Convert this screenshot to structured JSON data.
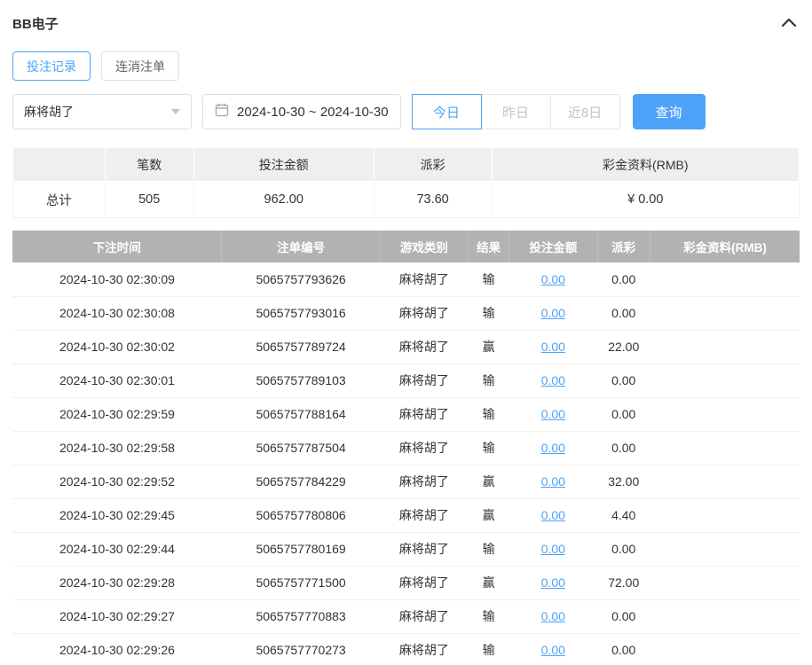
{
  "accent_color": "#4da3f7",
  "header": {
    "title": "BB电子"
  },
  "tabs": [
    {
      "label": "投注记录",
      "active": true
    },
    {
      "label": "连消注单",
      "active": false
    }
  ],
  "filters": {
    "game_select_value": "麻将胡了",
    "date_range_value": "2024-10-30 ~ 2024-10-30",
    "quick_buttons": [
      {
        "label": "今日",
        "active": true
      },
      {
        "label": "昨日",
        "active": false
      },
      {
        "label": "近8日",
        "active": false
      }
    ],
    "search_label": "查询"
  },
  "summary": {
    "headers": [
      "",
      "笔数",
      "投注金额",
      "派彩",
      "彩金资料(RMB)"
    ],
    "row_label": "总计",
    "count": "505",
    "bet_total": "962.00",
    "payout_total": "73.60",
    "bonus_total": "¥ 0.00"
  },
  "table": {
    "headers": [
      "下注时间",
      "注单编号",
      "游戏类别",
      "结果",
      "投注金额",
      "派彩",
      "彩金资料(RMB)"
    ],
    "rows": [
      {
        "time": "2024-10-30 02:30:09",
        "order": "5065757793626",
        "game": "麻将胡了",
        "result": "输",
        "bet": "0.00",
        "payout": "0.00",
        "bonus": ""
      },
      {
        "time": "2024-10-30 02:30:08",
        "order": "5065757793016",
        "game": "麻将胡了",
        "result": "输",
        "bet": "0.00",
        "payout": "0.00",
        "bonus": ""
      },
      {
        "time": "2024-10-30 02:30:02",
        "order": "5065757789724",
        "game": "麻将胡了",
        "result": "赢",
        "bet": "0.00",
        "payout": "22.00",
        "bonus": ""
      },
      {
        "time": "2024-10-30 02:30:01",
        "order": "5065757789103",
        "game": "麻将胡了",
        "result": "输",
        "bet": "0.00",
        "payout": "0.00",
        "bonus": ""
      },
      {
        "time": "2024-10-30 02:29:59",
        "order": "5065757788164",
        "game": "麻将胡了",
        "result": "输",
        "bet": "0.00",
        "payout": "0.00",
        "bonus": ""
      },
      {
        "time": "2024-10-30 02:29:58",
        "order": "5065757787504",
        "game": "麻将胡了",
        "result": "输",
        "bet": "0.00",
        "payout": "0.00",
        "bonus": ""
      },
      {
        "time": "2024-10-30 02:29:52",
        "order": "5065757784229",
        "game": "麻将胡了",
        "result": "赢",
        "bet": "0.00",
        "payout": "32.00",
        "bonus": ""
      },
      {
        "time": "2024-10-30 02:29:45",
        "order": "5065757780806",
        "game": "麻将胡了",
        "result": "赢",
        "bet": "0.00",
        "payout": "4.40",
        "bonus": ""
      },
      {
        "time": "2024-10-30 02:29:44",
        "order": "5065757780169",
        "game": "麻将胡了",
        "result": "输",
        "bet": "0.00",
        "payout": "0.00",
        "bonus": ""
      },
      {
        "time": "2024-10-30 02:29:28",
        "order": "5065757771500",
        "game": "麻将胡了",
        "result": "赢",
        "bet": "0.00",
        "payout": "72.00",
        "bonus": ""
      },
      {
        "time": "2024-10-30 02:29:27",
        "order": "5065757770883",
        "game": "麻将胡了",
        "result": "输",
        "bet": "0.00",
        "payout": "0.00",
        "bonus": ""
      },
      {
        "time": "2024-10-30 02:29:26",
        "order": "5065757770273",
        "game": "麻将胡了",
        "result": "输",
        "bet": "0.00",
        "payout": "0.00",
        "bonus": ""
      }
    ]
  }
}
